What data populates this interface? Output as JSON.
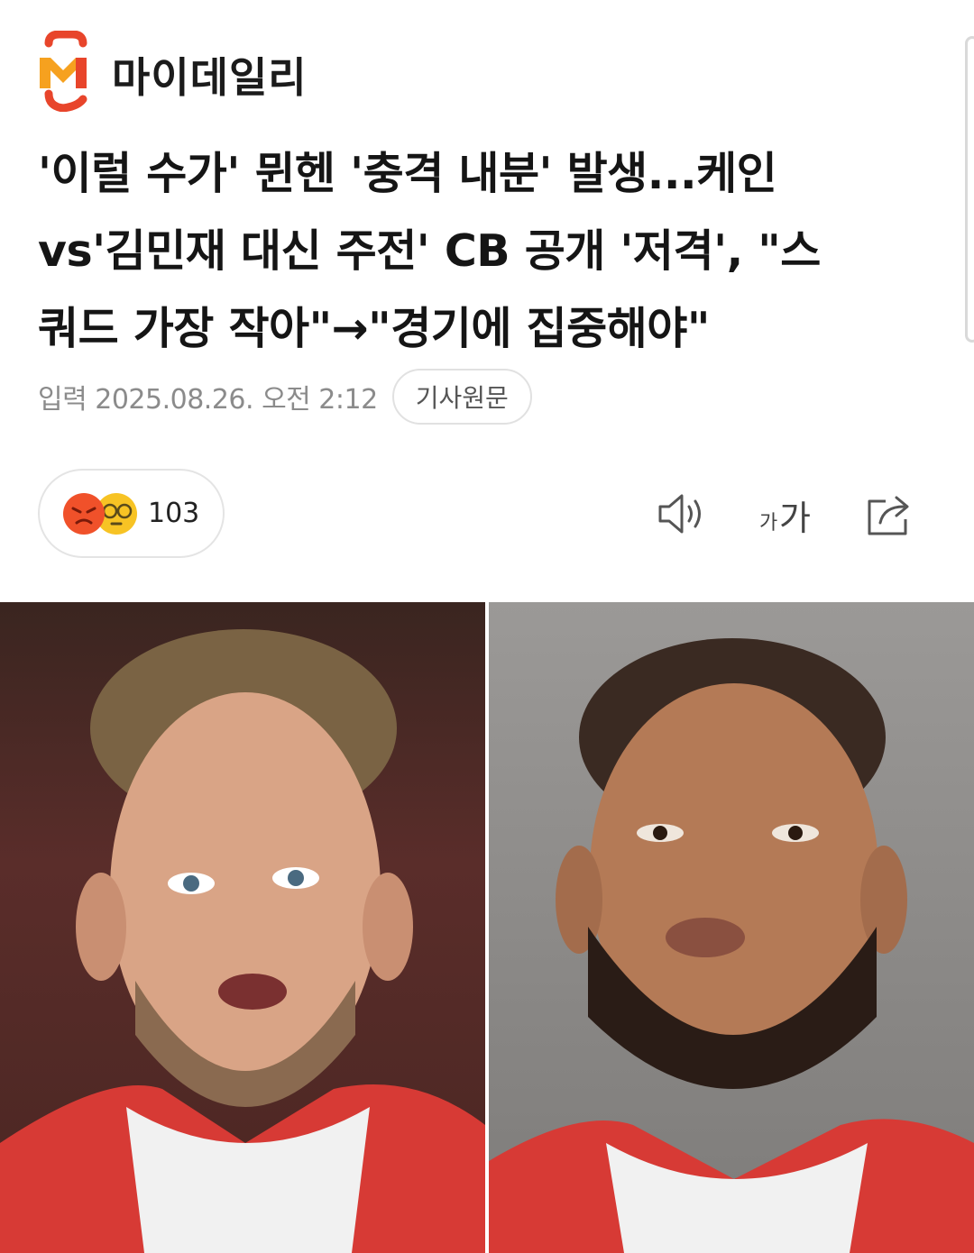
{
  "brand": {
    "name": "마이데일리",
    "logo_icon": "mydaily-logo-icon",
    "logo_colors": [
      "#e8452b",
      "#f6a11f"
    ]
  },
  "article": {
    "headline_lines": [
      "'이럴 수가' 뮌헨 '충격 내분' 발생...케인",
      "vs'김민재 대신 주전' CB 공개 '저격', \"스",
      "쿼드 가장 작아\"→\"경기에 집중해야\""
    ],
    "published": "입력 2025.08.26. 오전 2:12",
    "original_link_label": "기사원문"
  },
  "reactions": {
    "icons": [
      "angry-face-icon",
      "dizzy-face-icon"
    ],
    "count": "103"
  },
  "toolbar": {
    "speaker_icon": "speaker-icon",
    "font_size_small": "가",
    "font_size_large": "가",
    "share_icon": "share-icon"
  },
  "photo": {
    "left_person": "player-left-photo",
    "right_person": "player-right-photo"
  }
}
